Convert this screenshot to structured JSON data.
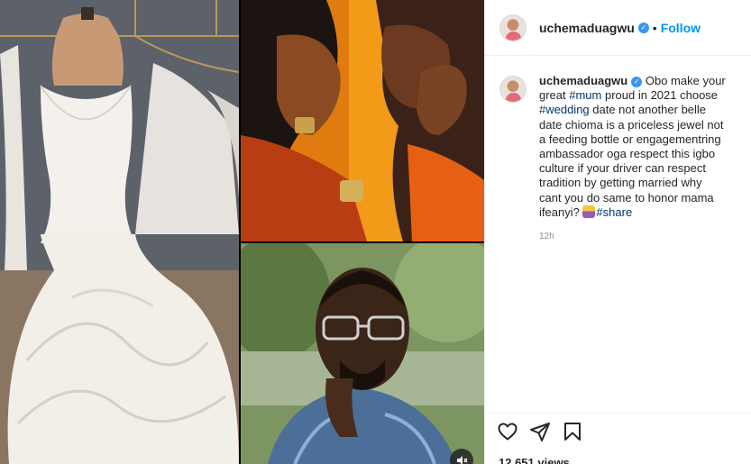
{
  "post": {
    "username": "uchemaduagwu",
    "follow_label": "Follow",
    "separator": "•",
    "caption_parts": {
      "p1": "Obo make your great ",
      "tag_mum": "#mum",
      "p2": " proud in 2021 choose ",
      "tag_wedding": "#wedding",
      "p3": " date not another belle date chioma is a priceless jewel not a feeding bottle or engagementring ambassador oga respect this igbo culture if your driver can respect tradition by getting married why cant you do same to honor mama ifeanyi? ",
      "tag_share": "#share"
    },
    "timestamp": "12h",
    "views": "12,651 views"
  },
  "icons": {
    "verified": "verified-badge-icon",
    "like": "heart-icon",
    "share": "send-icon",
    "save": "bookmark-icon",
    "mute": "speaker-muted-icon"
  },
  "colors": {
    "link": "#0095f6",
    "hashtag": "#00376b",
    "verified": "#3897f0"
  }
}
